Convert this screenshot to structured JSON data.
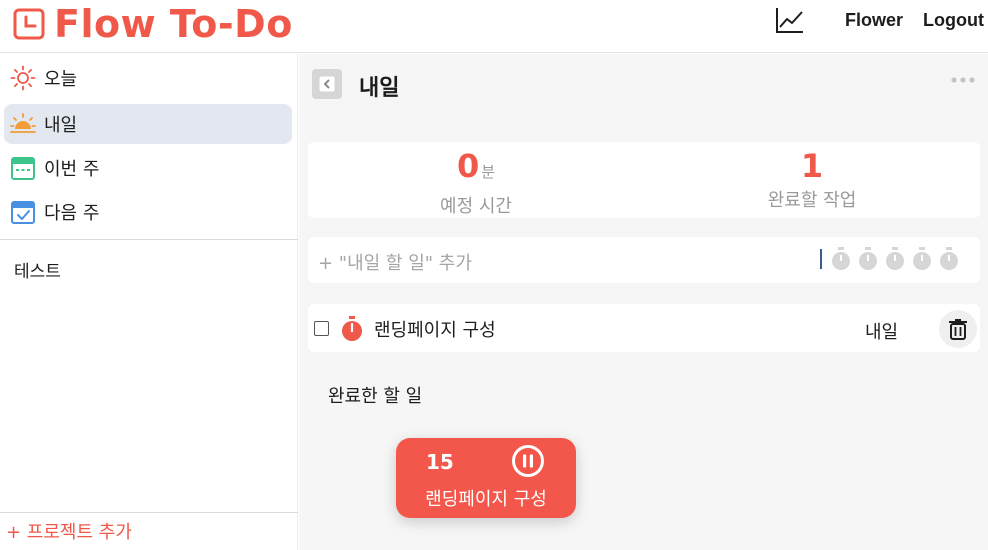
{
  "app": {
    "title": "Flow To-Do"
  },
  "header": {
    "nav": [
      "Flower",
      "Logout"
    ],
    "stats_icon": "line-chart-icon"
  },
  "sidebar": {
    "items": [
      {
        "label": "오늘",
        "icon": "sun-icon",
        "color": "#f0584a"
      },
      {
        "label": "내일",
        "icon": "sunrise-icon",
        "color": "#f39c3a",
        "active": true
      },
      {
        "label": "이번 주",
        "icon": "calendar-week-icon",
        "color": "#3cc48a"
      },
      {
        "label": "다음 주",
        "icon": "calendar-check-icon",
        "color": "#4a90e2"
      }
    ],
    "projects": [
      "테스트"
    ],
    "add_project": "+ 프로젝트 추가"
  },
  "main": {
    "title": "내일",
    "stats": [
      {
        "value": "0",
        "unit": "분",
        "label": "예정 시간"
      },
      {
        "value": "1",
        "unit": "",
        "label": "완료할 작업"
      }
    ],
    "add_task_placeholder": "+ \"내일 할 일\" 추가",
    "pomodoro_count": 5,
    "tasks": [
      {
        "title": "랜딩페이지 구성",
        "due": "내일",
        "done": false
      }
    ],
    "completed_header": "완료한 할 일"
  },
  "float_timer": {
    "count": "15",
    "title": "랜딩페이지 구성"
  },
  "colors": {
    "accent": "#f0584a",
    "active_bg": "#e3e7ef",
    "main_bg": "#f6f6f6"
  }
}
